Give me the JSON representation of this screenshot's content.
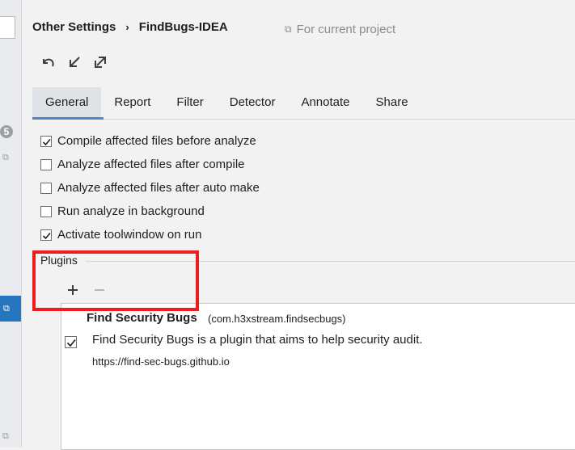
{
  "breadcrumb": {
    "parent": "Other Settings",
    "separator": "›",
    "current": "FindBugs-IDEA"
  },
  "scope_label": "For current project",
  "left_strip": {
    "badge": "5"
  },
  "tabs": [
    {
      "label": "General",
      "active": true
    },
    {
      "label": "Report"
    },
    {
      "label": "Filter"
    },
    {
      "label": "Detector"
    },
    {
      "label": "Annotate"
    },
    {
      "label": "Share"
    }
  ],
  "options": [
    {
      "label": "Compile affected files before analyze",
      "checked": true
    },
    {
      "label": "Analyze affected files after compile",
      "checked": false
    },
    {
      "label": "Analyze affected files after auto make",
      "checked": false
    },
    {
      "label": "Run analyze in background",
      "checked": false
    },
    {
      "label": "Activate toolwindow on run",
      "checked": true
    }
  ],
  "plugins": {
    "title": "Plugins",
    "items": [
      {
        "name": "Find Security Bugs",
        "id": "(com.h3xstream.findsecbugs)",
        "description": "Find Security Bugs is a plugin that aims to help security audit.",
        "url": "https://find-sec-bugs.github.io",
        "enabled": true
      }
    ]
  },
  "colors": {
    "accent": "#4a86c8",
    "highlight": "#ee1c1c",
    "selection": "#2675bf"
  }
}
